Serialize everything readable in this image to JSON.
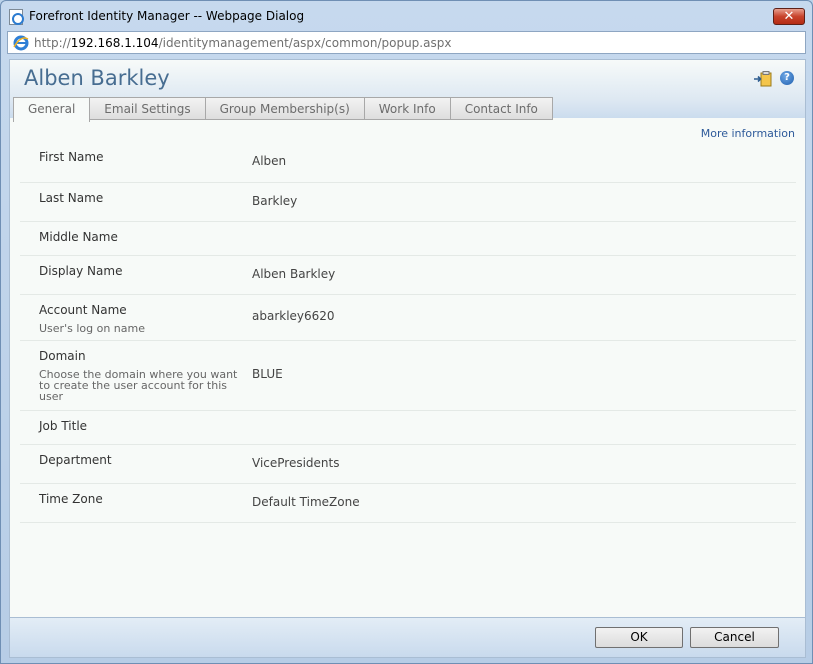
{
  "window": {
    "title": "Forefront Identity Manager -- Webpage Dialog",
    "close_label": "✕"
  },
  "address": {
    "scheme": "http://",
    "host": "192.168.1.104",
    "path": "/identitymanagement/aspx/common/popup.aspx"
  },
  "header": {
    "user_name": "Alben Barkley",
    "help_label": "?"
  },
  "tabs": [
    {
      "label": "General",
      "active": true
    },
    {
      "label": "Email Settings"
    },
    {
      "label": "Group Membership(s)"
    },
    {
      "label": "Work Info"
    },
    {
      "label": "Contact Info"
    }
  ],
  "more_information": "More information",
  "fields": [
    {
      "label": "First Name",
      "value": "Alben"
    },
    {
      "label": "Last Name",
      "value": "Barkley"
    },
    {
      "label": "Middle Name",
      "value": ""
    },
    {
      "label": "Display Name",
      "value": "Alben Barkley"
    },
    {
      "label": "Account Name",
      "hint": "User's log on name",
      "value": "abarkley6620"
    },
    {
      "label": "Domain",
      "hint": "Choose the domain where you want to create the user account for this user",
      "value": "BLUE"
    },
    {
      "label": "Job Title",
      "value": ""
    },
    {
      "label": "Department",
      "value": "VicePresidents"
    },
    {
      "label": "Time Zone",
      "value": "Default TimeZone"
    }
  ],
  "footer": {
    "ok_label": "OK",
    "cancel_label": "Cancel"
  }
}
